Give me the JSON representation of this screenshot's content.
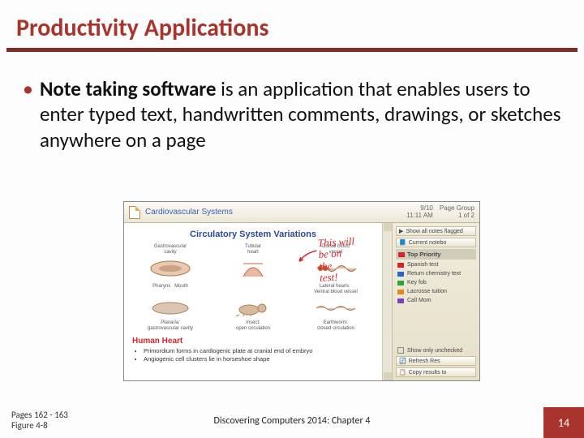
{
  "title": "Productivity Applications",
  "bullet": {
    "bold": "Note taking software",
    "rest": " is an application that enables users to enter typed text, handwritten comments, drawings, or sketches anywhere on a page"
  },
  "app": {
    "title": "Cardiovascular Systems",
    "date": "9/10",
    "time": "11:11 AM",
    "pagegroup_label": "Page Group",
    "pagegroup_value": "1 of 2",
    "note_heading": "Circulatory System Variations",
    "vessels": [
      {
        "top": "Gastrovascular",
        "bottom": "cavity"
      },
      {
        "top": "Tubular",
        "bottom": "heart"
      },
      {
        "top": "Dorsal blood",
        "bottom": "vessel"
      }
    ],
    "vessel_sub": [
      {
        "a": "Pharynx",
        "b": "Mouth"
      },
      {
        "a": "",
        "b": ""
      },
      {
        "a": "Lateral",
        "b": "hearts",
        "c": "Ventral blood",
        "d": "vessel"
      }
    ],
    "handwriting": {
      "l1": "This will",
      "l2": "be on",
      "l3": "the",
      "l4": "test!"
    },
    "organisms": [
      {
        "name": "Planaria:",
        "mode": "gastrovascular cavity"
      },
      {
        "name": "Insect:",
        "mode": "open circulation"
      },
      {
        "name": "Earthworm:",
        "mode": "closed circulation"
      }
    ],
    "section": "Human Heart",
    "sub_bullets": [
      "Primordium forms in cardiogenic plate at cranial end of embryo",
      "Angiogenic cell clusters lie in horseshoe shape"
    ],
    "side": {
      "show_all": "Show all notes flagged",
      "current": "Current notebo",
      "header": "Top Priority",
      "items": [
        {
          "color": "red",
          "label": "Spanish test"
        },
        {
          "color": "blue",
          "label": "Return chemistry text"
        },
        {
          "color": "green",
          "label": "Key fob"
        },
        {
          "color": "orange",
          "label": "Lacrosse tuition"
        },
        {
          "color": "purple",
          "label": "Call Mom"
        }
      ],
      "show_only": "Show only unchecked",
      "refresh": "Refresh Res",
      "copy": "Copy results to"
    }
  },
  "footer": {
    "pages": "Pages 162 - 163",
    "figure": "Figure 4-8",
    "center": "Discovering Computers 2014: Chapter 4",
    "slide": "14"
  }
}
